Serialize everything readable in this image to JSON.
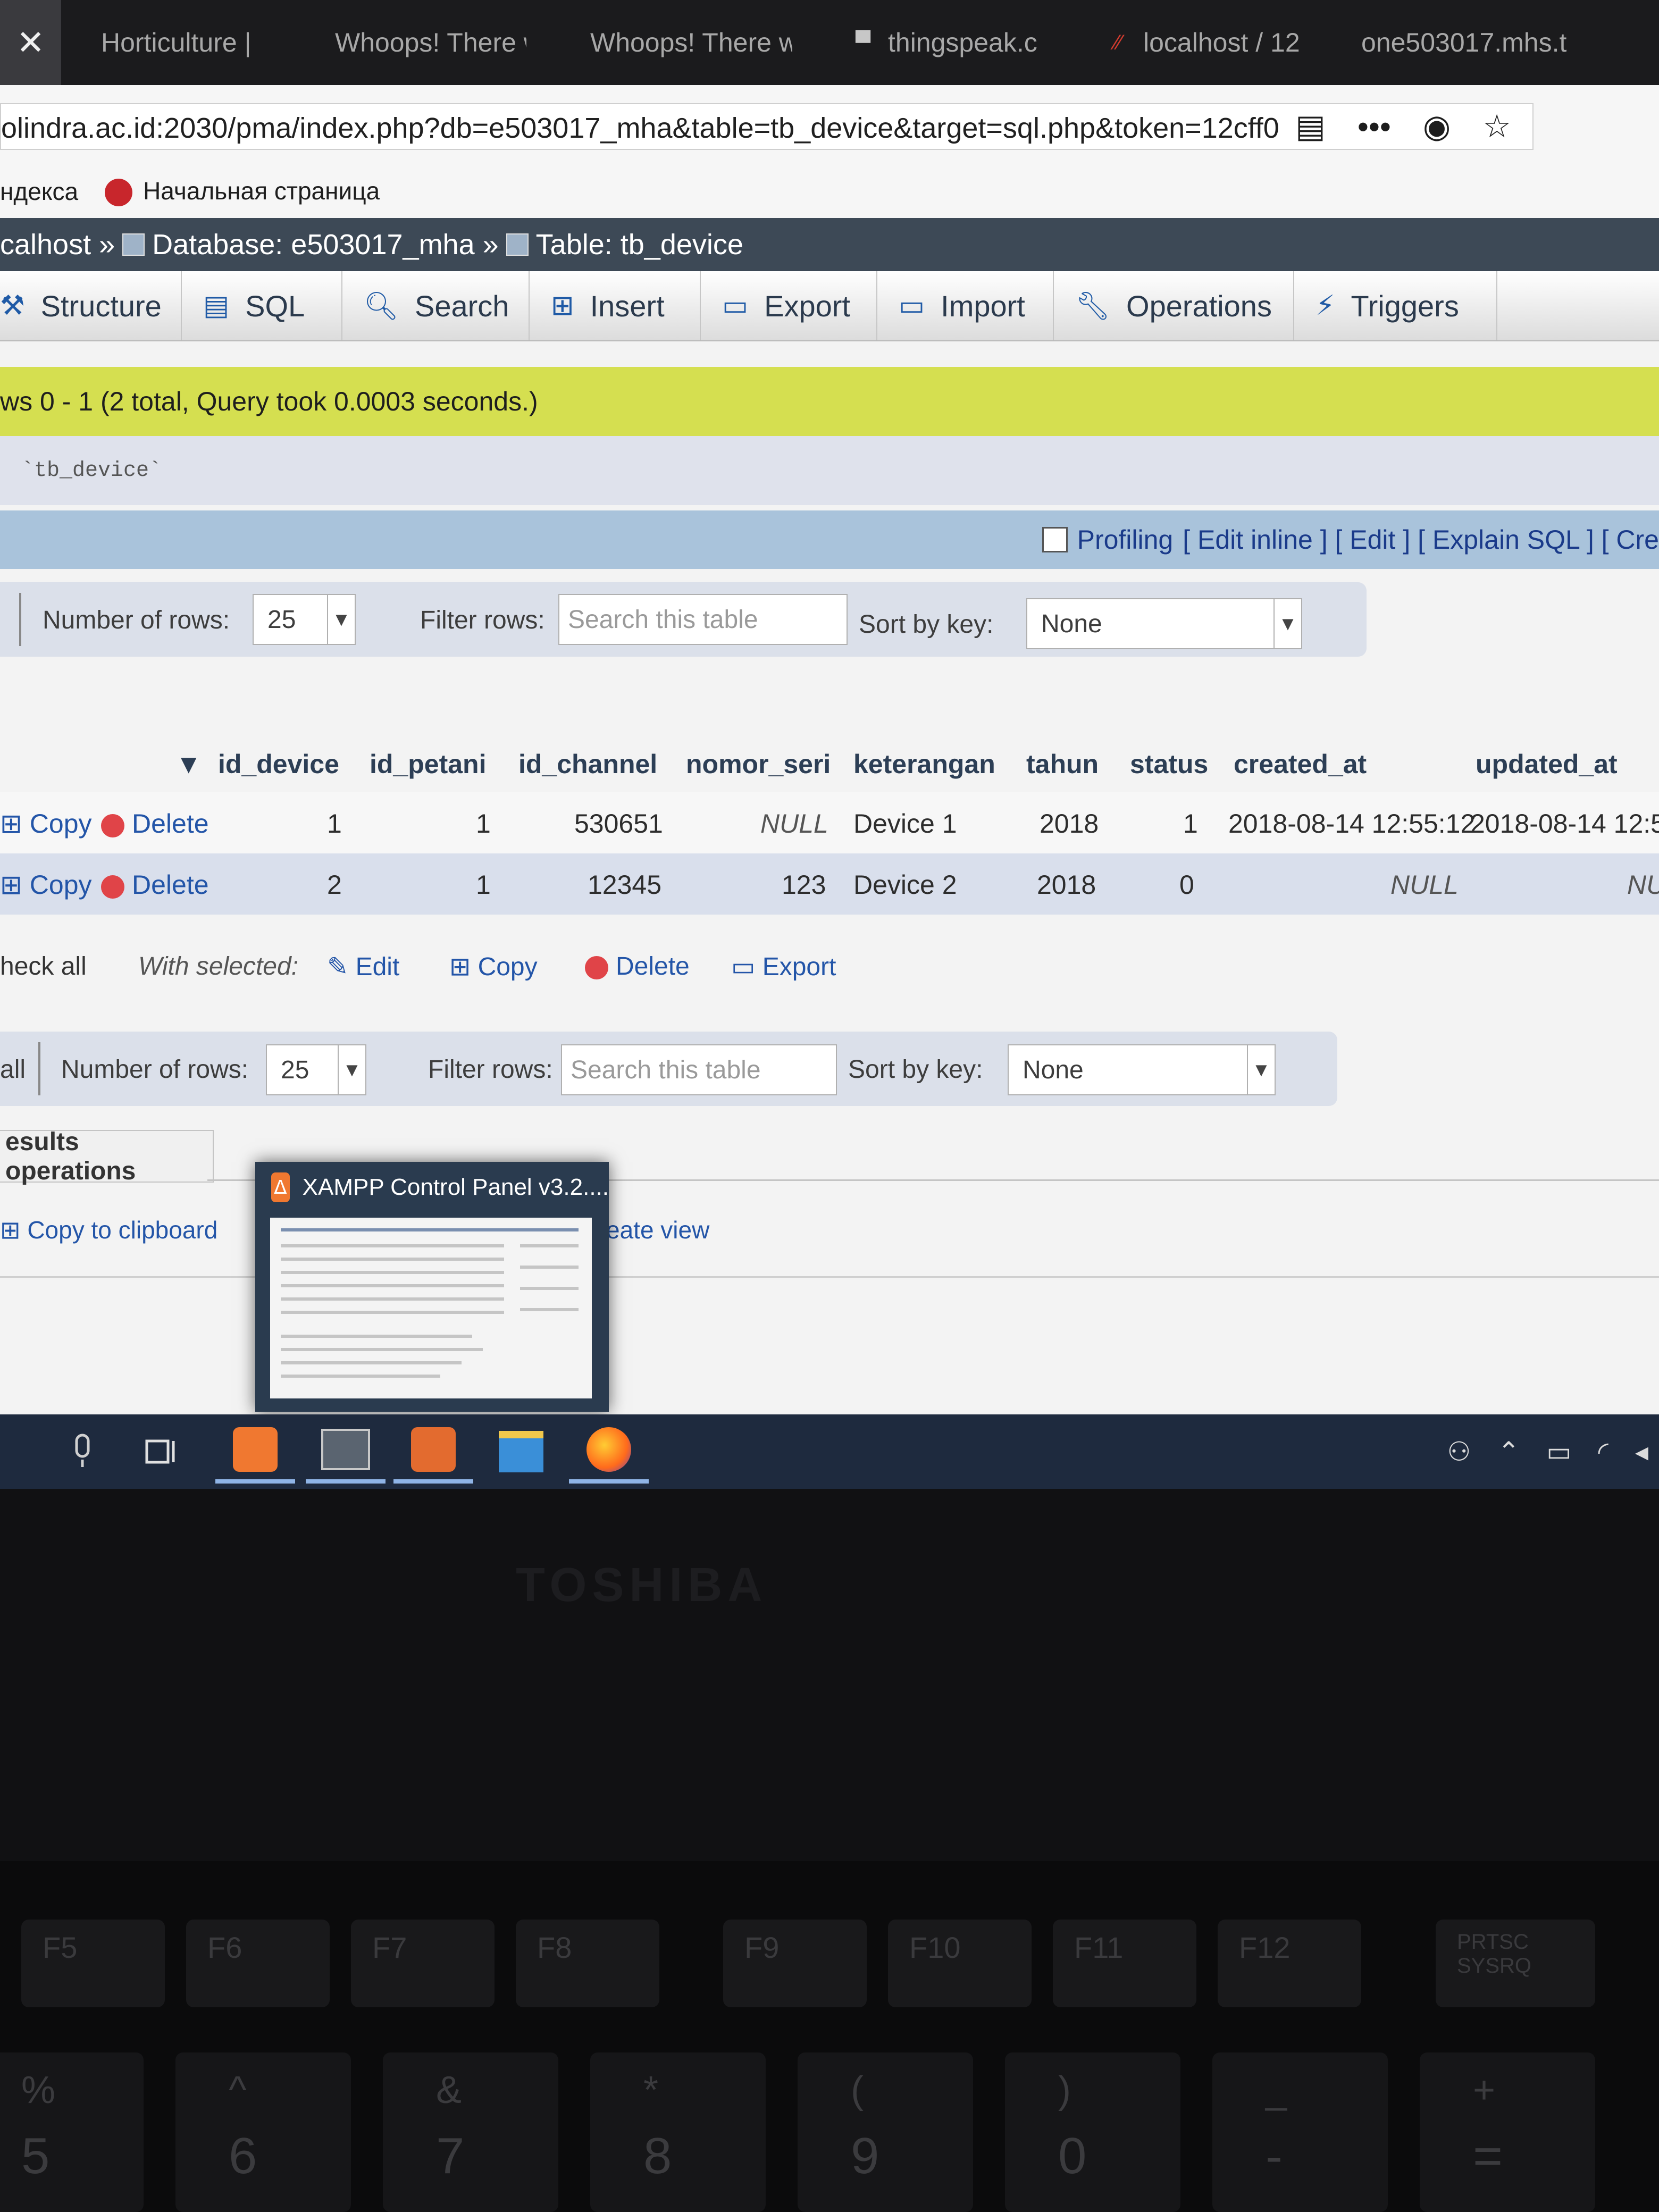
{
  "browser": {
    "close_glyph": "✕",
    "tabs": [
      {
        "label": "Horticulture |",
        "active": false
      },
      {
        "label": "Whoops! There w",
        "active": false
      },
      {
        "label": "Whoops! There w",
        "active": false
      },
      {
        "label": "thingspeak.c",
        "active": false
      },
      {
        "label": "localhost / 12",
        "active": false
      },
      {
        "label": "one503017.mhs.t",
        "active": false
      }
    ],
    "url": "olindra.ac.id:2030/pma/index.php?db=e503017_mha&table=tb_device&target=sql.php&token=12cff0",
    "menu_dots": "•••",
    "bookmarks": [
      "ндекса",
      "Начальная страница"
    ]
  },
  "breadcrumb": {
    "server": "calhost »",
    "database": "Database: e503017_mha »",
    "table": "Table: tb_device"
  },
  "menu": {
    "tabs": [
      "Structure",
      "SQL",
      "Search",
      "Insert",
      "Export",
      "Import",
      "Operations",
      "Triggers"
    ]
  },
  "result": {
    "message": "ws 0 - 1 (2 total, Query took 0.0003 seconds.)",
    "sql": "`tb_device`",
    "profiling": "Profiling",
    "links": "[ Edit inline ] [ Edit ] [ Explain SQL ] [ Cre"
  },
  "nav_top": {
    "rows_label": "Number of rows:",
    "rows_value": "25",
    "filter_label": "Filter rows:",
    "filter_placeholder": "Search this table",
    "sort_label": "Sort by key:",
    "sort_value": "None"
  },
  "nav_bottom": {
    "all": "all",
    "rows_label": "Number of rows:",
    "rows_value": "25",
    "filter_label": "Filter rows:",
    "filter_placeholder": "Search this table",
    "sort_label": "Sort by key:",
    "sort_value": "None"
  },
  "table": {
    "columns": [
      "id_device",
      "id_petani",
      "id_channel",
      "nomor_seri",
      "keterangan",
      "tahun",
      "status",
      "created_at",
      "updated_at"
    ],
    "actions": {
      "copy": "Copy",
      "delete": "Delete"
    },
    "rows": [
      {
        "id_device": "1",
        "id_petani": "1",
        "id_channel": "530651",
        "nomor_seri": "NULL",
        "keterangan": "Device 1",
        "tahun": "2018",
        "status": "1",
        "created_at": "2018-08-14 12:55:12",
        "updated_at": "2018-08-14 12:55"
      },
      {
        "id_device": "2",
        "id_petani": "1",
        "id_channel": "12345",
        "nomor_seri": "123",
        "keterangan": "Device 2",
        "tahun": "2018",
        "status": "0",
        "created_at": "NULL",
        "updated_at": "NU"
      }
    ]
  },
  "with_selected": {
    "check_all": "heck all",
    "label": "With selected:",
    "edit": "Edit",
    "copy": "Copy",
    "delete": "Delete",
    "export": "Export"
  },
  "results_ops": {
    "title": "esults operations",
    "copy_clipboard": "Copy to clipboard",
    "create_view": "eate view"
  },
  "xampp_thumb": {
    "title": "XAMPP Control Panel v3.2...."
  },
  "laptop": {
    "brand": "TOSHIBA",
    "fkeys": [
      "F5",
      "F6",
      "F7",
      "F8",
      "F9",
      "F10",
      "F11",
      "F12",
      "PRTSC SYSRQ"
    ],
    "numkeys": [
      {
        "top": "%",
        "bottom": "5"
      },
      {
        "top": "^",
        "bottom": "6"
      },
      {
        "top": "&",
        "bottom": "7"
      },
      {
        "top": "*",
        "bottom": "8"
      },
      {
        "top": "(",
        "bottom": "9"
      },
      {
        "top": ")",
        "bottom": "0"
      },
      {
        "top": "_",
        "bottom": "-"
      },
      {
        "top": "+",
        "bottom": "="
      }
    ]
  }
}
